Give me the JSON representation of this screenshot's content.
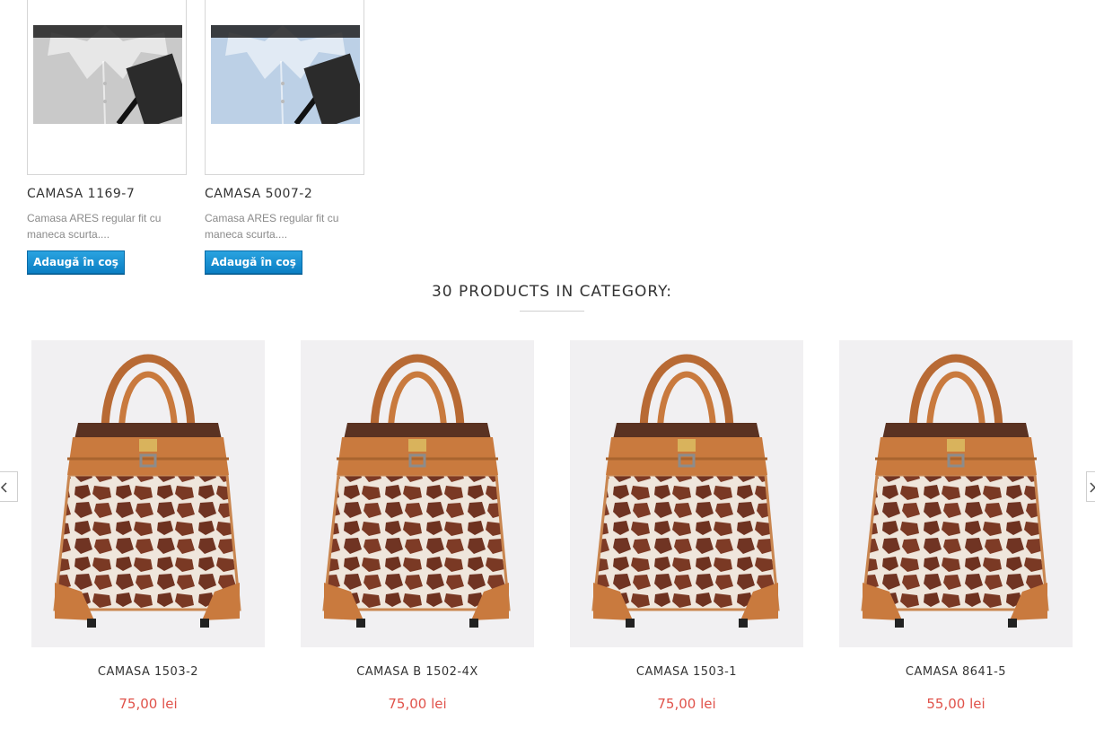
{
  "top_products": [
    {
      "name": "CAMASA 1169-7",
      "description": "Camasa ARES regular fit cu maneca scurta....",
      "button_label": "Adaugă în coş",
      "image_icon": "shirt-image-icon"
    },
    {
      "name": "CAMASA 5007-2",
      "description": "Camasa ARES regular fit cu maneca scurta....",
      "button_label": "Adaugă în coş",
      "image_icon": "shirt-image-icon"
    }
  ],
  "category": {
    "title": "30 PRODUCTS IN CATEGORY:"
  },
  "carousel": {
    "prev_icon": "chevron-left-icon",
    "next_icon": "chevron-right-icon",
    "items": [
      {
        "name": "CAMASA 1503-2",
        "price": "75,00 lei",
        "image_icon": "giraffe-bag-image-icon"
      },
      {
        "name": "CAMASA B 1502-4X",
        "price": "75,00 lei",
        "image_icon": "giraffe-bag-image-icon"
      },
      {
        "name": "CAMASA 1503-1",
        "price": "75,00 lei",
        "image_icon": "giraffe-bag-image-icon"
      },
      {
        "name": "CAMASA 8641-5",
        "price": "55,00 lei",
        "image_icon": "giraffe-bag-image-icon"
      }
    ]
  },
  "colors": {
    "button_blue": "#1590d3",
    "price_red": "#e0524a",
    "bag_brown": "#c97a3e",
    "spot_brown": "#6b2f1c"
  }
}
